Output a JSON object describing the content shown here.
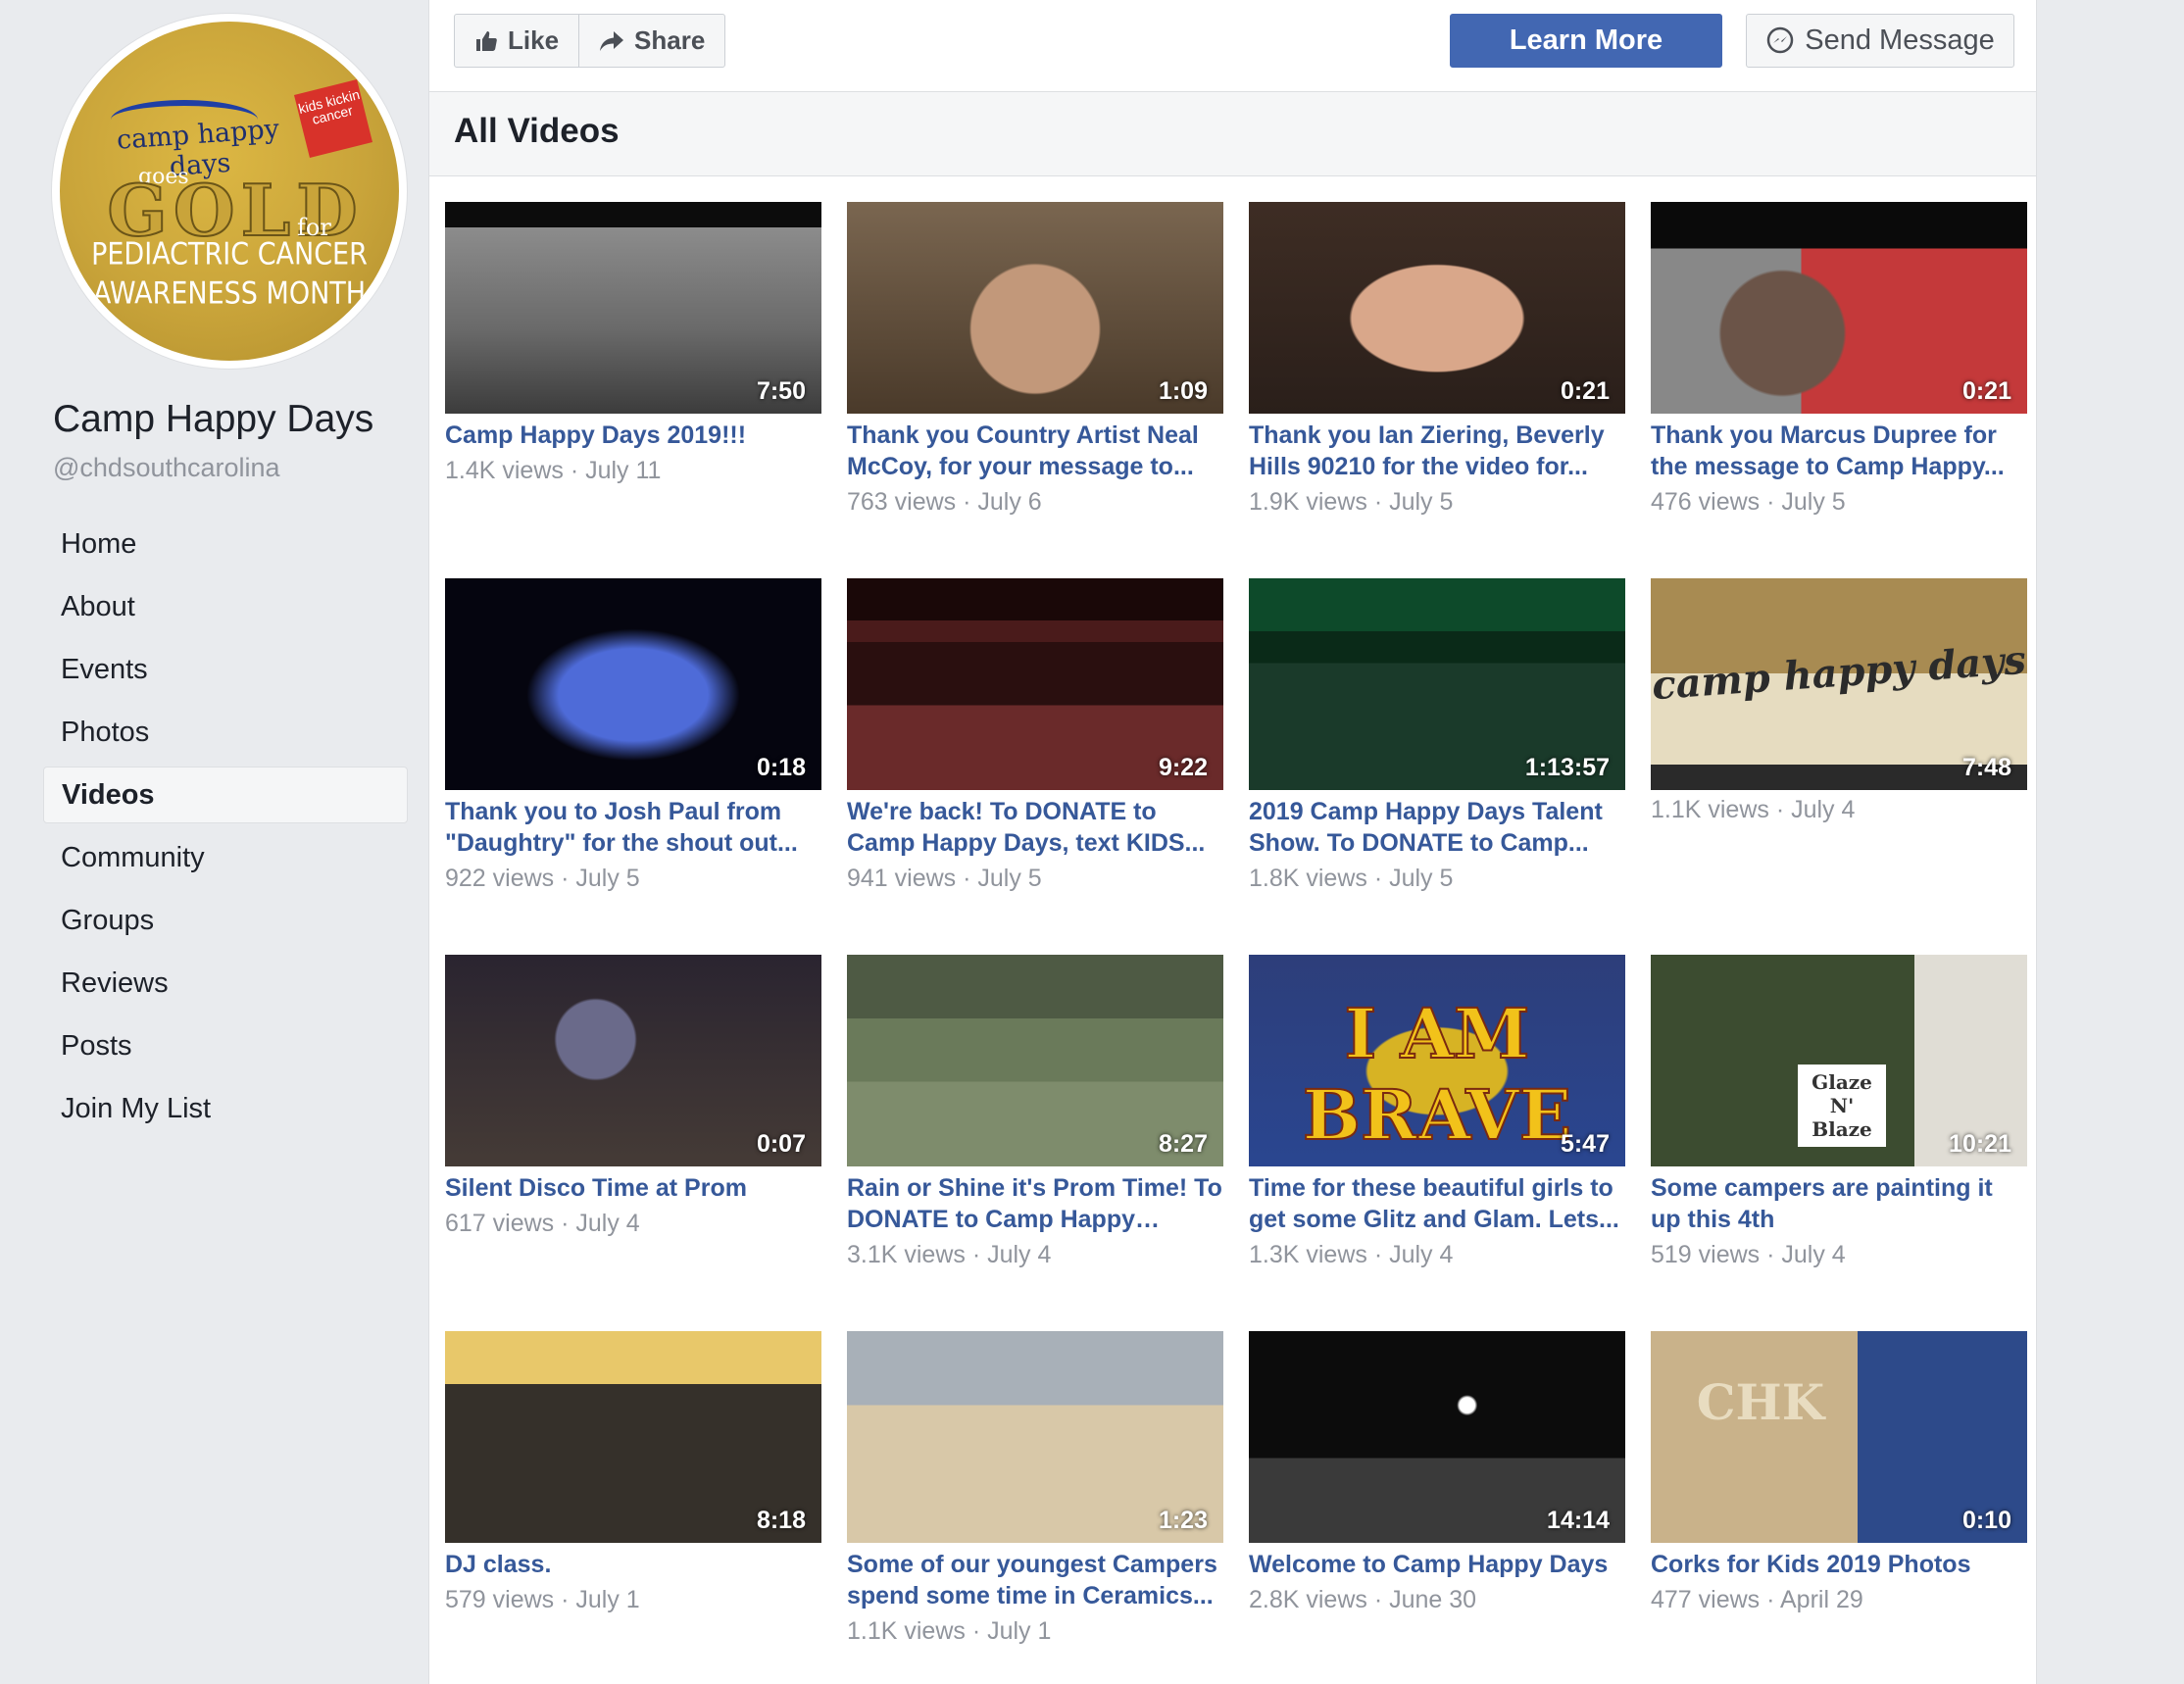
{
  "sidebar": {
    "profile_logo": {
      "camp_text": "camp happy days",
      "kids_badge": "kids kickin cancer",
      "goes": "goes",
      "gold": "GOLD",
      "for": "for",
      "line1": "PEDIACTRIC CANCER",
      "line2": "AWARENESS MONTH"
    },
    "page_name": "Camp Happy Days",
    "handle": "@chdsouthcarolina",
    "nav": [
      {
        "label": "Home"
      },
      {
        "label": "About"
      },
      {
        "label": "Events"
      },
      {
        "label": "Photos"
      },
      {
        "label": "Videos",
        "active": true
      },
      {
        "label": "Community"
      },
      {
        "label": "Groups"
      },
      {
        "label": "Reviews"
      },
      {
        "label": "Posts"
      },
      {
        "label": "Join My List"
      }
    ]
  },
  "actionbar": {
    "like_label": "Like",
    "share_label": "Share",
    "learn_more_label": "Learn More",
    "send_message_label": "Send Message"
  },
  "videos": {
    "header": "All Videos",
    "items": [
      {
        "title": "Camp Happy Days 2019!!!",
        "duration": "7:50",
        "meta": "1.4K views · July 11"
      },
      {
        "title": "Thank you Country Artist Neal McCoy, for your message to...",
        "duration": "1:09",
        "meta": "763 views · July 6"
      },
      {
        "title": "Thank you Ian Ziering, Beverly Hills 90210 for the video for...",
        "duration": "0:21",
        "meta": "1.9K views · July 5"
      },
      {
        "title": "Thank you Marcus Dupree for the message to Camp Happy...",
        "duration": "0:21",
        "meta": "476 views · July 5"
      },
      {
        "title": "Thank you to Josh Paul from \"Daughtry\" for the shout out...",
        "duration": "0:18",
        "meta": "922 views · July 5"
      },
      {
        "title": "We're back! To DONATE to Camp Happy Days, text KIDS...",
        "duration": "9:22",
        "meta": "941 views · July 5"
      },
      {
        "title": "2019 Camp Happy Days Talent Show. To DONATE to Camp...",
        "duration": "1:13:57",
        "meta": "1.8K views · July 5"
      },
      {
        "title": "",
        "duration": "7:48",
        "meta": "1.1K views · July 4",
        "thumb_text": "camp happy days"
      },
      {
        "title": "Silent Disco Time at Prom",
        "duration": "0:07",
        "meta": "617 views · July 4"
      },
      {
        "title": "Rain or Shine it's Prom Time! To DONATE to Camp Happy Days,...",
        "duration": "8:27",
        "meta": "3.1K views · July 4"
      },
      {
        "title": "Time for these beautiful girls to get some Glitz and Glam. Lets...",
        "duration": "5:47",
        "meta": "1.3K views · July 4",
        "thumb_text": "I AM BRAVE"
      },
      {
        "title": "Some campers are painting it up this 4th",
        "duration": "10:21",
        "meta": "519 views · July 4",
        "thumb_text": "Glaze N' Blaze"
      },
      {
        "title": "DJ class.",
        "duration": "8:18",
        "meta": "579 views · July 1"
      },
      {
        "title": "Some of our youngest Campers spend some time in Ceramics...",
        "duration": "1:23",
        "meta": "1.1K views · July 1"
      },
      {
        "title": "Welcome to Camp Happy Days",
        "duration": "14:14",
        "meta": "2.8K views · June 30"
      },
      {
        "title": "Corks for Kids 2019 Photos",
        "duration": "0:10",
        "meta": "477 views · April 29",
        "thumb_text": "CHK"
      }
    ]
  },
  "colors": {
    "page_bg": "#e9ebee",
    "link_blue": "#365899",
    "button_blue": "#4267b2",
    "meta_gray": "#90949c"
  }
}
